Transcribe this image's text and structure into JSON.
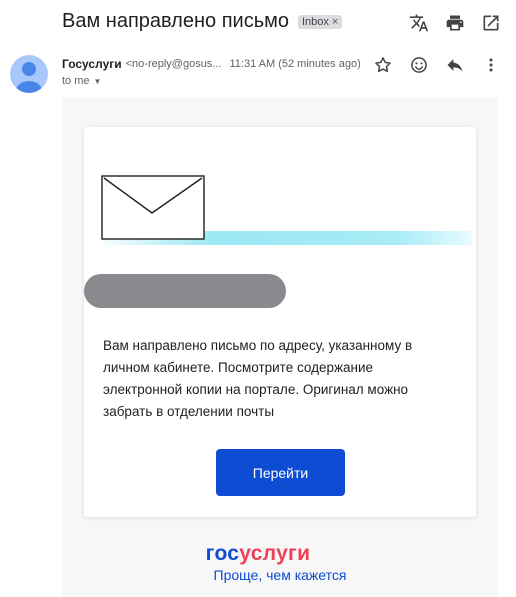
{
  "header": {
    "subject": "Вам направлено письмо",
    "label_badge": "Inbox",
    "label_remove": "×",
    "actions": [
      "translate-icon",
      "print-icon",
      "open-in-new-window-icon"
    ]
  },
  "message": {
    "sender_name": "Госуслуги",
    "sender_email": "<no-reply@gosus...",
    "time": "11:31 AM (52 minutes ago)",
    "recipient": "to me",
    "recipient_caret": "▼",
    "actions": [
      "star-icon",
      "emoji-icon",
      "reply-icon",
      "more-vert-icon"
    ]
  },
  "email": {
    "body_text": "Вам направлено письмо по адресу, указанному в личном кабинете. Посмотрите содержание электронной копии на портале. Оригинал можно забрать в отделении почты",
    "button_label": "Перейти",
    "logo": {
      "part1": "гос",
      "part2": "услуги"
    },
    "tagline": "Проще, чем кажется"
  },
  "colors": {
    "brand_blue": "#0d4cd3",
    "brand_red": "#ee3f58",
    "avatar_bg": "#a8c7fa"
  }
}
